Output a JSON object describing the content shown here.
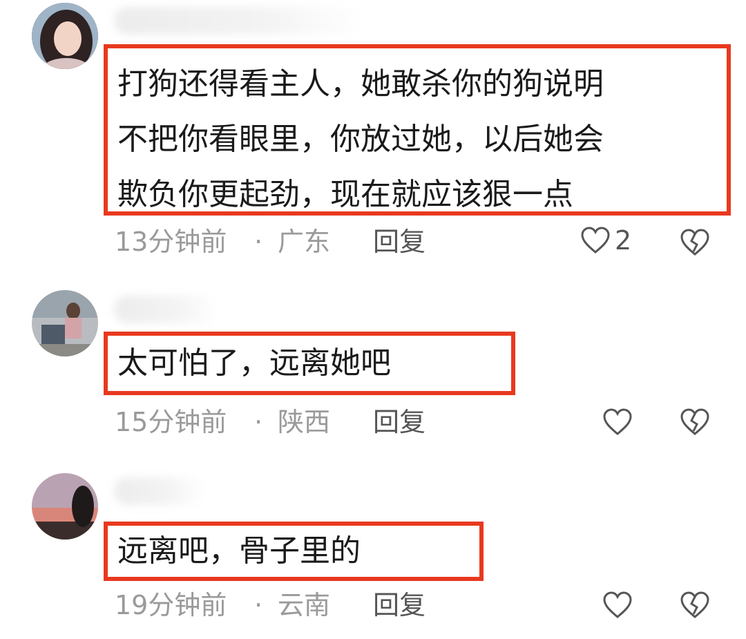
{
  "colors": {
    "highlight_border": "#e8391f",
    "meta_text": "#9a9a9a",
    "body_text": "#1a1a1a"
  },
  "comments": [
    {
      "text_lines": [
        "打狗还得看主人，她敢杀你的狗说明",
        "不把你看眼里，你放过她，以后她会",
        "欺负你更起劲，现在就应该狠一点"
      ],
      "time": "13分钟前",
      "separator": "·",
      "region": "广东",
      "reply_label": "回复",
      "like_count": "2",
      "like_icon": "heart-outline-icon",
      "dislike_icon": "broken-heart-icon"
    },
    {
      "text_lines": [
        "太可怕了，远离她吧"
      ],
      "time": "15分钟前",
      "separator": "·",
      "region": "陕西",
      "reply_label": "回复",
      "like_count": "",
      "like_icon": "heart-outline-icon",
      "dislike_icon": "broken-heart-icon"
    },
    {
      "text_lines": [
        "远离吧，骨子里的"
      ],
      "time": "19分钟前",
      "separator": "·",
      "region": "云南",
      "reply_label": "回复",
      "like_count": "",
      "like_icon": "heart-outline-icon",
      "dislike_icon": "broken-heart-icon"
    }
  ]
}
